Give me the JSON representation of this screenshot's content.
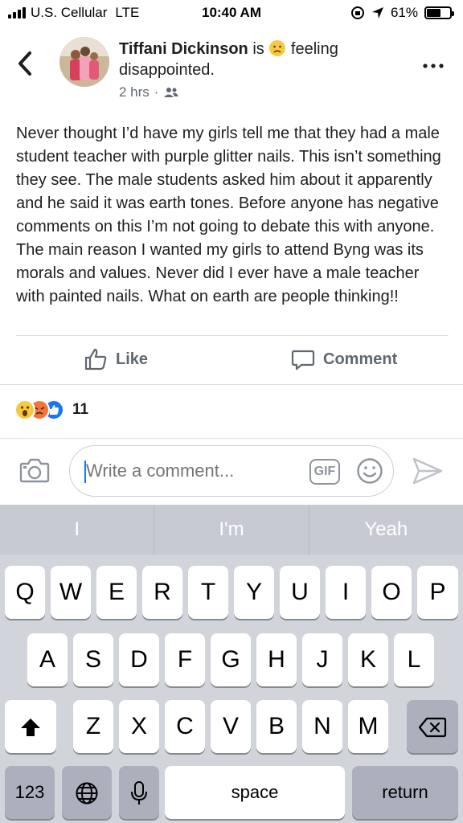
{
  "status_bar": {
    "carrier": "U.S. Cellular",
    "network": "LTE",
    "time": "10:40 AM",
    "battery_percent": "61%",
    "battery_level": 0.61
  },
  "post": {
    "author": "Tiffani Dickinson",
    "feeling_prefix": "is",
    "feeling_text": "feeling disappointed.",
    "time_ago": "2 hrs",
    "audience_icon": "friends-icon",
    "body": "Never thought I’d have my girls tell me that they had a male student teacher with purple glitter nails. This isn’t something they see. The male students asked him about it apparently and he said it was earth tones. Before anyone has negative comments on this I’m not going to debate this with anyone. The main reason I wanted my girls to attend Byng was its morals and values. Never did I ever have a male teacher with painted nails. What on earth are people thinking!!"
  },
  "actions": {
    "like_label": "Like",
    "comment_label": "Comment"
  },
  "reactions": {
    "types": [
      "wow",
      "angry",
      "like"
    ],
    "count": "11"
  },
  "composer": {
    "placeholder": "Write a comment...",
    "gif_label": "GIF"
  },
  "keyboard": {
    "suggestions": [
      "I",
      "I'm",
      "Yeah"
    ],
    "row1": [
      "Q",
      "W",
      "E",
      "R",
      "T",
      "Y",
      "U",
      "I",
      "O",
      "P"
    ],
    "row2": [
      "A",
      "S",
      "D",
      "F",
      "G",
      "H",
      "J",
      "K",
      "L"
    ],
    "row3": [
      "Z",
      "X",
      "C",
      "V",
      "B",
      "N",
      "M"
    ],
    "numbers_label": "123",
    "space_label": "space",
    "return_label": "return"
  },
  "colors": {
    "accent": "#1877f2",
    "secondary_text": "#606770",
    "keyboard_bg": "#d1d5db"
  }
}
